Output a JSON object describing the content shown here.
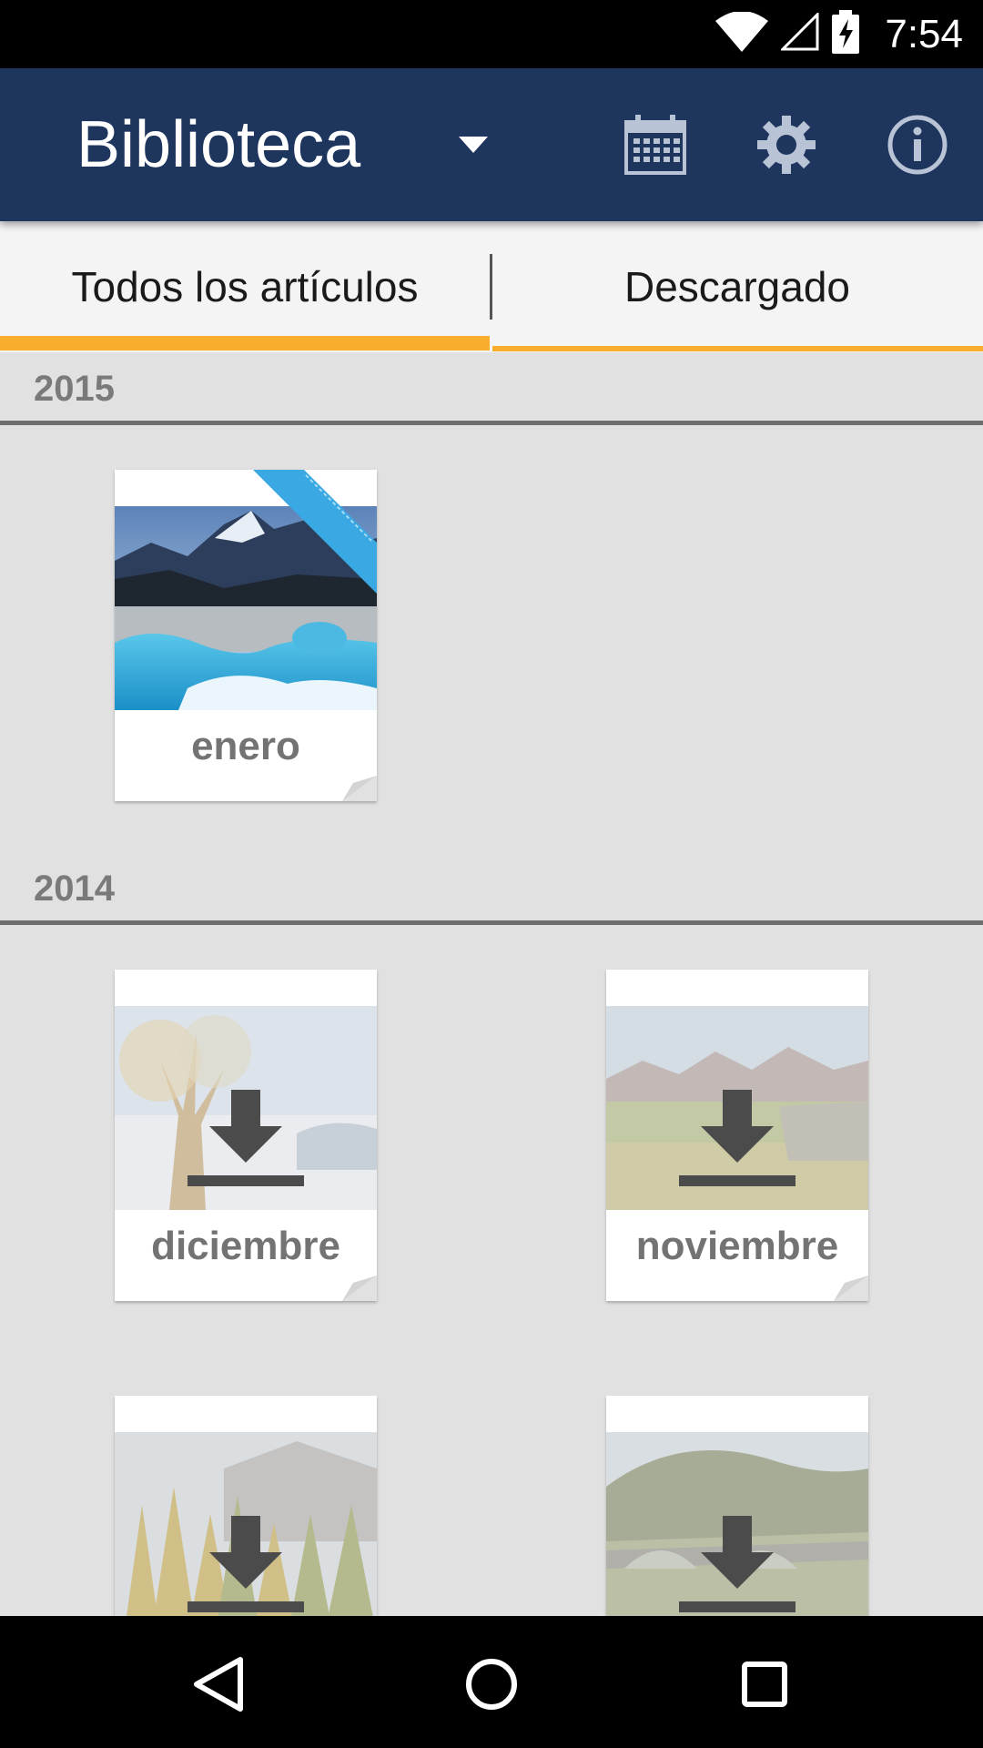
{
  "status_bar": {
    "time": "7:54"
  },
  "app_bar": {
    "title": "Biblioteca",
    "icons": [
      "dropdown-arrow-icon",
      "calendar-icon",
      "settings-gear-icon",
      "info-icon"
    ]
  },
  "tabs": [
    {
      "label": "Todos los artículos",
      "active": true
    },
    {
      "label": "Descargado",
      "active": false
    }
  ],
  "colors": {
    "app_bar": "#1e355e",
    "tab_indicator": "#f8ad2c",
    "ribbon": "#3aa8e2",
    "background": "#e1e1e1"
  },
  "sections": [
    {
      "year": "2015",
      "items": [
        {
          "label": "enero",
          "downloaded": true,
          "new_ribbon": true
        }
      ]
    },
    {
      "year": "2014",
      "items": [
        {
          "label": "diciembre",
          "downloaded": false
        },
        {
          "label": "noviembre",
          "downloaded": false
        },
        {
          "label": "",
          "downloaded": false
        },
        {
          "label": "",
          "downloaded": false
        }
      ]
    }
  ],
  "nav_bar": {
    "buttons": [
      "back-icon",
      "home-icon",
      "recents-icon"
    ]
  }
}
